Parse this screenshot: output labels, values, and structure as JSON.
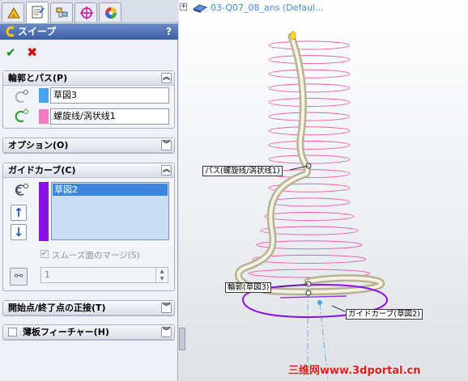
{
  "tree": {
    "document_name": "03-Q07_08_ans  (Defaul..."
  },
  "panel": {
    "title": "スイープ",
    "help": "?",
    "ok_symbol": "✔",
    "cancel_symbol": "✖",
    "profile_path": {
      "header": "輪郭とパス(P)",
      "profile_value": "草図3",
      "path_value": "螺旋线/涡状线1"
    },
    "options": {
      "header": "オプション(O)"
    },
    "guide_curves": {
      "header": "ガイドカーブ(C)",
      "items": [
        "草図2"
      ],
      "smooth_label": "スムーズ面のマージ(S)",
      "spinner_value": "1"
    },
    "start_end_tangency": {
      "header": "開始点/終了点の正接(T)"
    },
    "thin_feature": {
      "header": "薄板フィーチャー(H)"
    }
  },
  "viewport": {
    "label_path": "パス(螺旋线/涡状线1)",
    "label_profile": "輪郭(草図3)",
    "label_guide": "ガイドカーブ(草図2)",
    "watermark": "三维网www.3dportal.cn"
  }
}
